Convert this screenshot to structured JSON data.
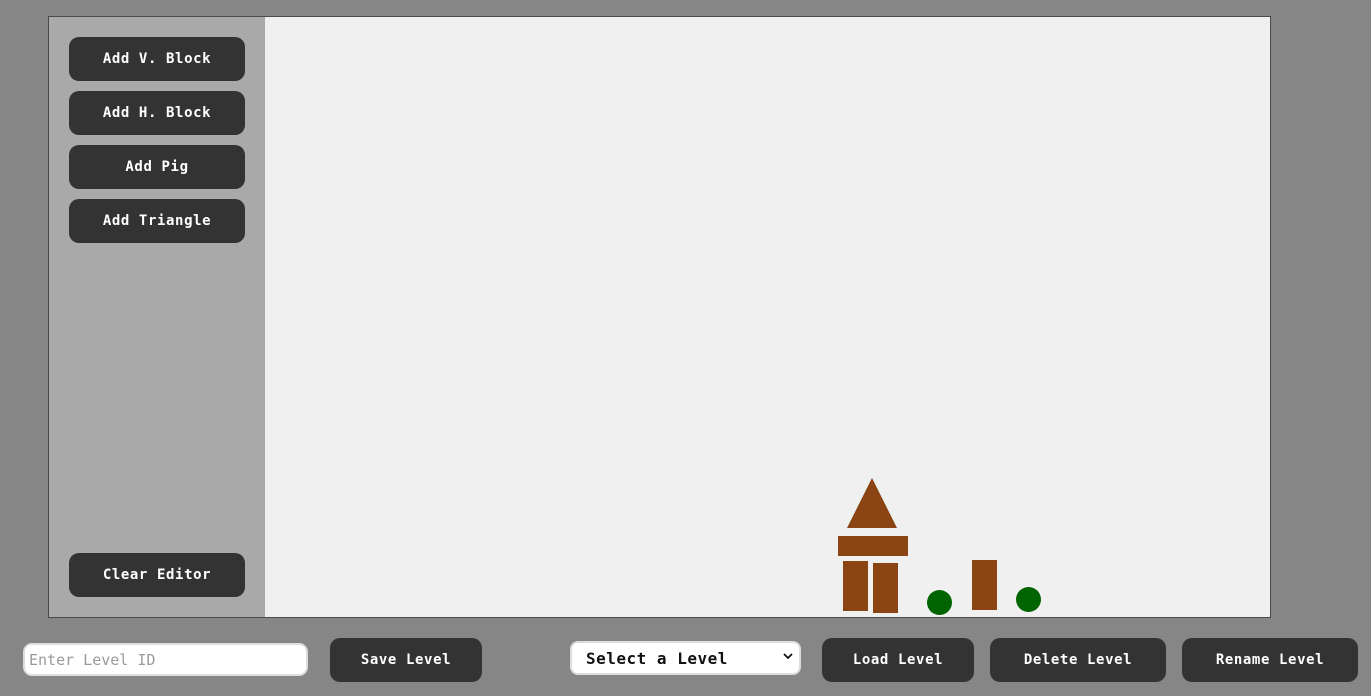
{
  "sidebar": {
    "add_v_block": "Add V. Block",
    "add_h_block": "Add H. Block",
    "add_pig": "Add Pig",
    "add_triangle": "Add Triangle",
    "clear_editor": "Clear Editor"
  },
  "level_id_input": {
    "placeholder": "Enter Level ID",
    "value": ""
  },
  "save_level": "Save Level",
  "level_select": {
    "selected": "Select a Level"
  },
  "load_level": "Load Level",
  "delete_level": "Delete Level",
  "rename_level": "Rename Level",
  "colors": {
    "block": "#8b4513",
    "pig": "#006400",
    "sidebar": "#a9a9a9",
    "canvas": "#f0f0f0",
    "button": "#333333",
    "page": "#868686"
  }
}
